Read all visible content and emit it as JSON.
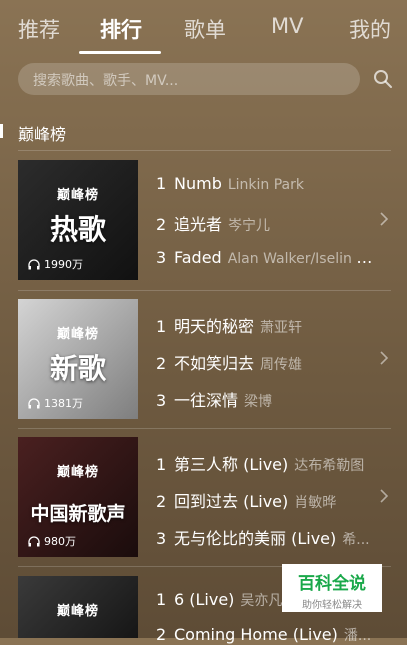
{
  "tabs": [
    {
      "label": "推荐"
    },
    {
      "label": "排行"
    },
    {
      "label": "歌单"
    },
    {
      "label": "MV"
    },
    {
      "label": "我的"
    }
  ],
  "search": {
    "placeholder": "搜索歌曲、歌手、MV..."
  },
  "section": {
    "title": "巅峰榜"
  },
  "charts": [
    {
      "badge": "巅峰榜",
      "title": "热歌",
      "plays": "1990万",
      "songs": [
        {
          "rank": "1",
          "name": "Numb",
          "artist": "Linkin Park"
        },
        {
          "rank": "2",
          "name": "追光者",
          "artist": "岑宁儿"
        },
        {
          "rank": "3",
          "name": "Faded",
          "artist": "Alan Walker/Iselin S..."
        }
      ]
    },
    {
      "badge": "巅峰榜",
      "title": "新歌",
      "plays": "1381万",
      "songs": [
        {
          "rank": "1",
          "name": "明天的秘密",
          "artist": "萧亚轩"
        },
        {
          "rank": "2",
          "name": "不如笑归去",
          "artist": "周传雄"
        },
        {
          "rank": "3",
          "name": "一往深情",
          "artist": "梁博"
        }
      ]
    },
    {
      "badge": "巅峰榜",
      "title": "中国新歌声",
      "plays": "980万",
      "songs": [
        {
          "rank": "1",
          "name": "第三人称 (Live)",
          "artist": "达布希勒图"
        },
        {
          "rank": "2",
          "name": "回到过去 (Live)",
          "artist": "肖敏晔"
        },
        {
          "rank": "3",
          "name": "无与伦比的美丽 (Live)",
          "artist": "希..."
        }
      ]
    },
    {
      "badge": "巅峰榜",
      "title": "",
      "plays": "",
      "songs": [
        {
          "rank": "1",
          "name": "6 (Live)",
          "artist": "吴亦凡"
        },
        {
          "rank": "2",
          "name": "Coming Home (Live)",
          "artist": "潘..."
        }
      ]
    }
  ],
  "watermark": {
    "title": "百科全说",
    "subtitle": "助你轻松解决"
  }
}
